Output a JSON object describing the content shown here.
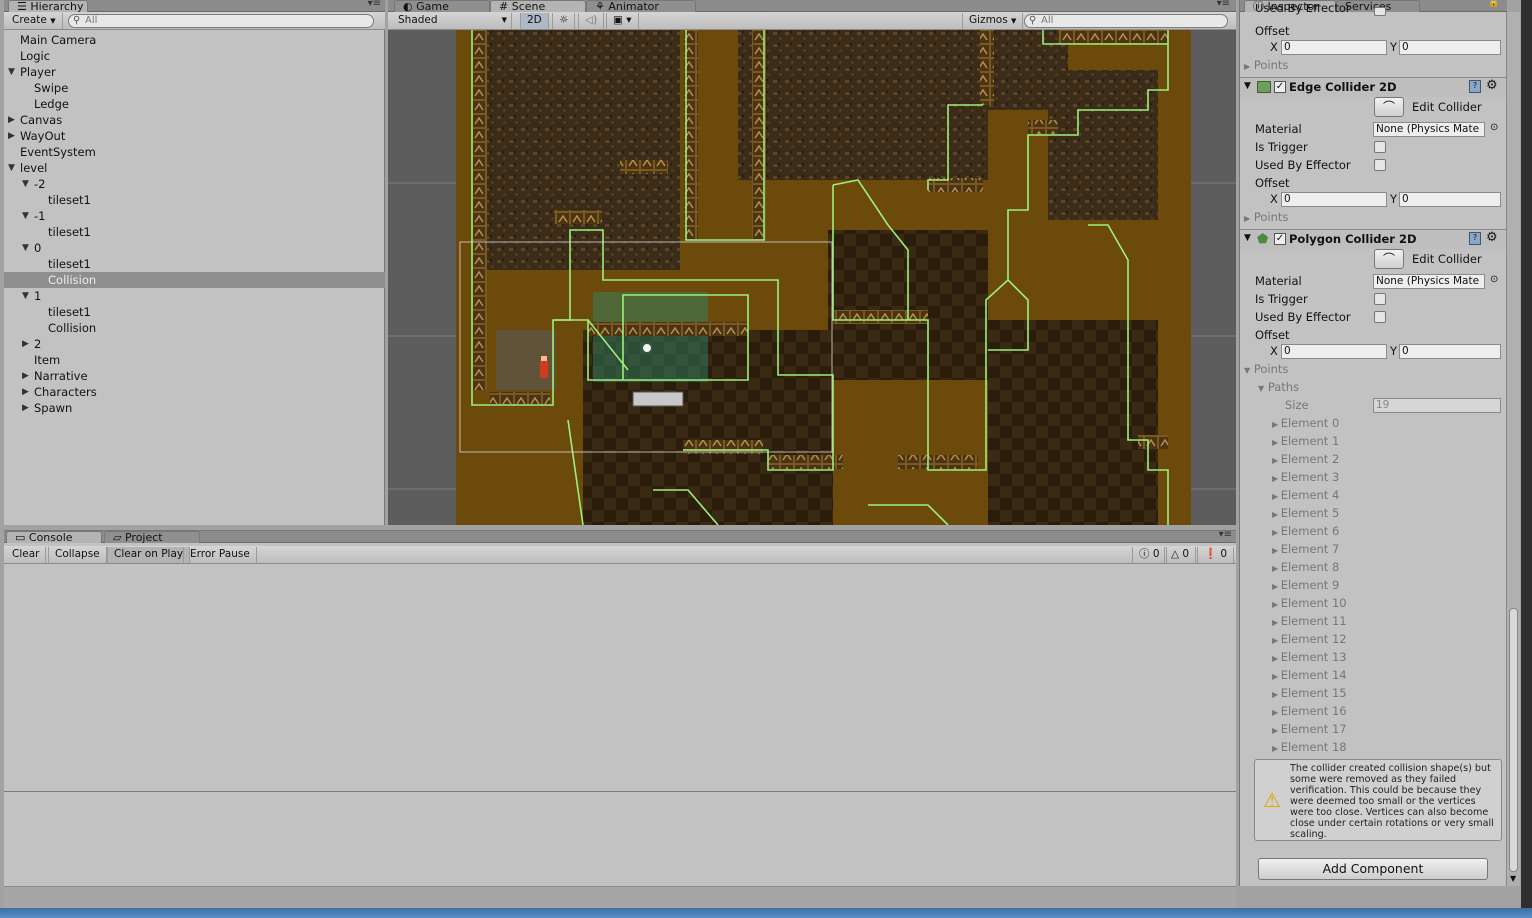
{
  "hierarchy": {
    "tab": "Hierarchy",
    "create": "Create",
    "search_placeholder": "All",
    "items": [
      {
        "label": "Main Camera",
        "indent": 0,
        "arrow": ""
      },
      {
        "label": "Logic",
        "indent": 0,
        "arrow": ""
      },
      {
        "label": "Player",
        "indent": 0,
        "arrow": "▼"
      },
      {
        "label": "Swipe",
        "indent": 1,
        "arrow": ""
      },
      {
        "label": "Ledge",
        "indent": 1,
        "arrow": ""
      },
      {
        "label": "Canvas",
        "indent": 0,
        "arrow": "▶"
      },
      {
        "label": "WayOut",
        "indent": 0,
        "arrow": "▶"
      },
      {
        "label": "EventSystem",
        "indent": 0,
        "arrow": ""
      },
      {
        "label": "level",
        "indent": 0,
        "arrow": "▼"
      },
      {
        "label": "-2",
        "indent": 1,
        "arrow": "▼"
      },
      {
        "label": "tileset1",
        "indent": 2,
        "arrow": ""
      },
      {
        "label": "-1",
        "indent": 1,
        "arrow": "▼"
      },
      {
        "label": "tileset1",
        "indent": 2,
        "arrow": ""
      },
      {
        "label": "0",
        "indent": 1,
        "arrow": "▼"
      },
      {
        "label": "tileset1",
        "indent": 2,
        "arrow": ""
      },
      {
        "label": "Collision",
        "indent": 2,
        "arrow": "",
        "selected": true
      },
      {
        "label": "1",
        "indent": 1,
        "arrow": "▼"
      },
      {
        "label": "tileset1",
        "indent": 2,
        "arrow": ""
      },
      {
        "label": "Collision",
        "indent": 2,
        "arrow": ""
      },
      {
        "label": "2",
        "indent": 1,
        "arrow": "▶"
      },
      {
        "label": "Item",
        "indent": 1,
        "arrow": ""
      },
      {
        "label": "Narrative",
        "indent": 1,
        "arrow": "▶"
      },
      {
        "label": "Characters",
        "indent": 1,
        "arrow": "▶"
      },
      {
        "label": "Spawn",
        "indent": 1,
        "arrow": "▶"
      }
    ]
  },
  "scene": {
    "tabs": [
      "Game",
      "Scene",
      "Animator"
    ],
    "shading": "Shaded",
    "mode_2d": "2D",
    "gizmos": "Gizmos",
    "search_placeholder": "All"
  },
  "console": {
    "tabs": [
      "Console",
      "Project"
    ],
    "buttons": [
      "Clear",
      "Collapse",
      "Clear on Play",
      "Error Pause"
    ],
    "counts": {
      "info": "0",
      "warn": "0",
      "error": "0"
    }
  },
  "inspector": {
    "tabs": [
      "Inspector",
      "Services"
    ],
    "top": {
      "used_by_effector": "Used By Effector",
      "offset": "Offset",
      "x_label": "X",
      "x_value": "0",
      "y_label": "Y",
      "y_value": "0",
      "points": "Points"
    },
    "edge": {
      "title": "Edge Collider 2D",
      "edit": "Edit Collider",
      "material_label": "Material",
      "material_value": "None (Physics Mate",
      "is_trigger": "Is Trigger",
      "used_by_effector": "Used By Effector",
      "offset": "Offset",
      "x_label": "X",
      "x_value": "0",
      "y_label": "Y",
      "y_value": "0",
      "points": "Points"
    },
    "poly": {
      "title": "Polygon Collider 2D",
      "edit": "Edit Collider",
      "material_label": "Material",
      "material_value": "None (Physics Mate",
      "is_trigger": "Is Trigger",
      "used_by_effector": "Used By Effector",
      "offset": "Offset",
      "x_label": "X",
      "x_value": "0",
      "y_label": "Y",
      "y_value": "0",
      "points": "Points",
      "paths": "Paths",
      "size_label": "Size",
      "size_value": "19",
      "elements": [
        "Element 0",
        "Element 1",
        "Element 2",
        "Element 3",
        "Element 4",
        "Element 5",
        "Element 6",
        "Element 7",
        "Element 8",
        "Element 9",
        "Element 10",
        "Element 11",
        "Element 12",
        "Element 13",
        "Element 14",
        "Element 15",
        "Element 16",
        "Element 17",
        "Element 18"
      ]
    },
    "warning": "The collider created collision shape(s) but some were removed as they failed verification.  This could be because they were deemed too small or the vertices were too close.  Vertices can also become close under certain rotations or very small scaling.",
    "add_component": "Add Component"
  },
  "colors": {
    "collider_green": "#9cf07a",
    "dirt_brown": "#6b4a0c",
    "rock_dark": "#2c2115",
    "selection": "#8e8e8e"
  }
}
